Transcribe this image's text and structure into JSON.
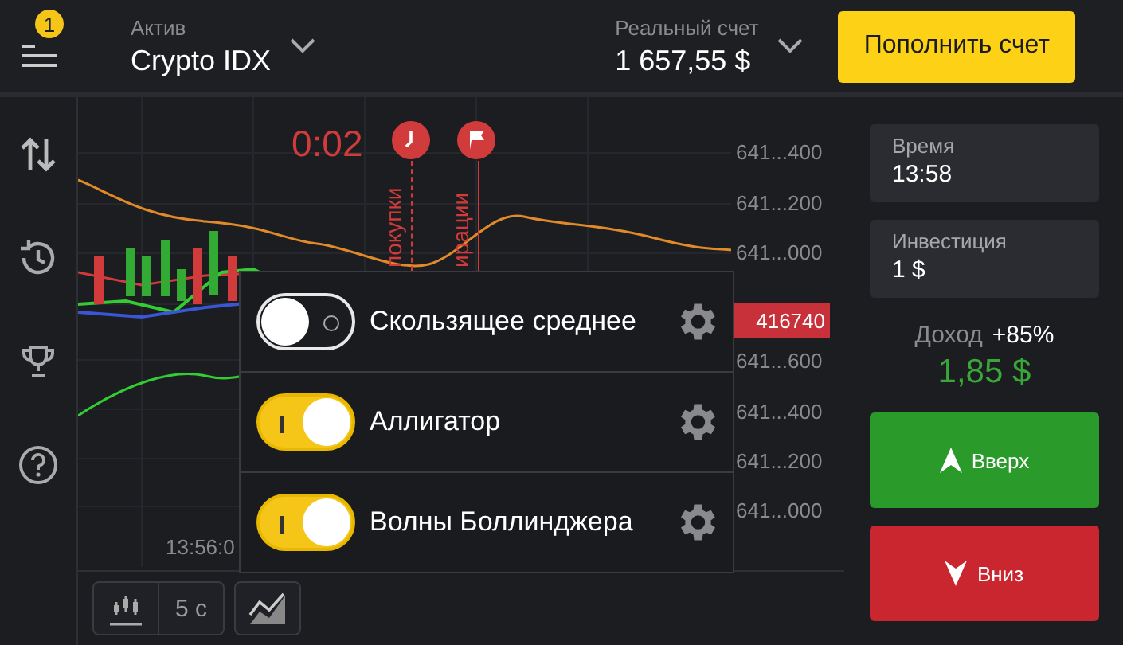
{
  "header": {
    "menu_badge": "1",
    "asset_label": "Актив",
    "asset": "Crypto IDX",
    "account_label": "Реальный счет",
    "balance": "1 657,55 $",
    "deposit_button": "Пополнить счет"
  },
  "chart": {
    "timer": "0:02",
    "markers": [
      {
        "kind": "purchase",
        "label": "покупки"
      },
      {
        "kind": "expiration",
        "label": "ирации"
      }
    ],
    "price_ticks": [
      "641...400",
      "641...200",
      "641...000",
      "641...600",
      "641...400",
      "641...200",
      "641...000"
    ],
    "current_price": "416740",
    "time_ticks": [
      "13:56:0"
    ]
  },
  "indicators": [
    {
      "name": "Скользящее среднее",
      "on": false
    },
    {
      "name": "Аллигатор",
      "on": true
    },
    {
      "name": "Волны Боллинджера",
      "on": true
    }
  ],
  "toolbar": {
    "interval": "5 с"
  },
  "trade": {
    "time_label": "Время",
    "time": "13:58",
    "investment_label": "Инвестиция",
    "investment": "1 $",
    "profit_label": "Доход",
    "profit_percent": "+85%",
    "profit_amount": "1,85 $",
    "up_button": "Вверх",
    "down_button": "Вниз"
  }
}
